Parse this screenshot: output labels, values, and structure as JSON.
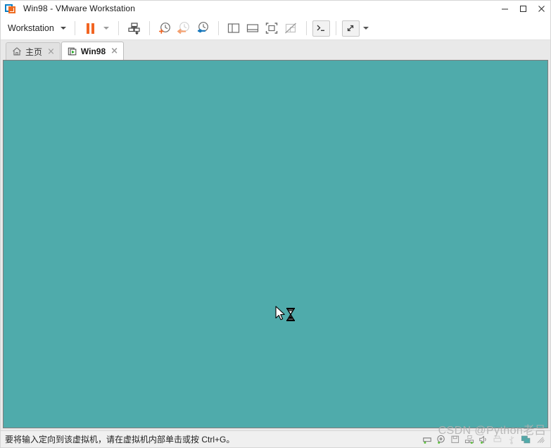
{
  "window": {
    "title": "Win98 - VMware Workstation",
    "app_icon": "vmware-workstation-icon",
    "controls": {
      "minimize": "minimize-icon",
      "maximize": "maximize-icon",
      "close": "close-icon"
    }
  },
  "toolbar": {
    "menu_label": "Workstation",
    "buttons": [
      {
        "name": "pause-vm-button",
        "icon": "pause-icon",
        "state": "enabled"
      },
      {
        "name": "power-dropdown-button",
        "icon": "chevron-down-icon",
        "state": "enabled"
      },
      {
        "name": "manage-vm-button",
        "icon": "vm-manage-icon",
        "state": "enabled"
      },
      {
        "name": "take-snapshot-button",
        "icon": "snapshot-add-icon",
        "state": "enabled"
      },
      {
        "name": "revert-snapshot-button",
        "icon": "snapshot-revert-icon",
        "state": "disabled"
      },
      {
        "name": "snapshot-manager-button",
        "icon": "snapshot-manager-icon",
        "state": "enabled"
      },
      {
        "name": "show-library-button",
        "icon": "library-panel-icon",
        "state": "enabled"
      },
      {
        "name": "show-thumbnail-bar-button",
        "icon": "thumbnail-bar-icon",
        "state": "enabled"
      },
      {
        "name": "enter-fullscreen-button",
        "icon": "fullscreen-icon",
        "state": "enabled"
      },
      {
        "name": "unity-mode-button",
        "icon": "unity-mode-disabled-icon",
        "state": "disabled"
      },
      {
        "name": "console-view-button",
        "icon": "terminal-icon",
        "state": "enabled"
      },
      {
        "name": "stretch-guest-button",
        "icon": "stretch-icon",
        "state": "enabled"
      },
      {
        "name": "stretch-dropdown-button",
        "icon": "chevron-down-icon",
        "state": "enabled"
      }
    ]
  },
  "tabs": [
    {
      "label": "主页",
      "icon": "home-icon",
      "active": false,
      "close": "×"
    },
    {
      "label": "Win98",
      "icon": "vm-running-icon",
      "active": true,
      "close": "×"
    }
  ],
  "vm": {
    "screen_color": "#4fabab",
    "cursor": "arrow-busy-cursor"
  },
  "statusbar": {
    "message": "要将输入定向到该虚拟机，请在虚拟机内部单击或按 Ctrl+G。",
    "devices": [
      {
        "name": "status-hard-disk-icon"
      },
      {
        "name": "status-cd-dvd-icon"
      },
      {
        "name": "status-floppy-icon"
      },
      {
        "name": "status-network-icon"
      },
      {
        "name": "status-sound-icon"
      },
      {
        "name": "status-printer-icon"
      },
      {
        "name": "status-usb-icon"
      },
      {
        "name": "status-display-icon"
      }
    ],
    "resize_grip": "resize-grip-icon"
  },
  "watermark": {
    "text": "CSDN @Python老吕"
  },
  "colors": {
    "accent_orange": "#f26522",
    "accent_blue": "#0b7ec4",
    "vm_teal": "#4fabab",
    "chrome_grey": "#e9e9e9"
  }
}
